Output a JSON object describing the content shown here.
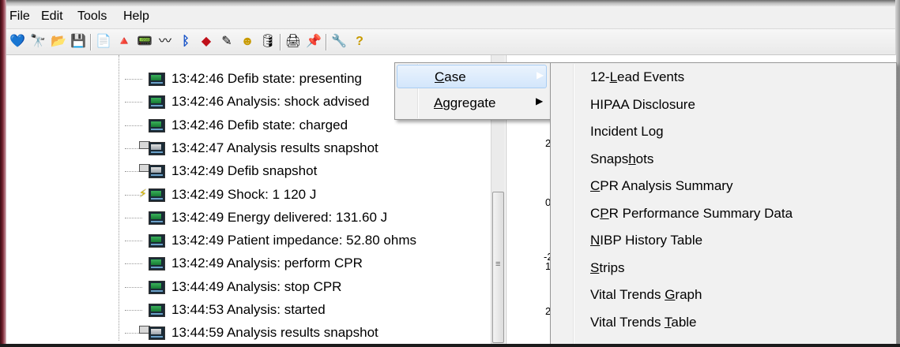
{
  "menubar": {
    "items": [
      {
        "label": "File"
      },
      {
        "label": "Edit"
      },
      {
        "label": "Tools"
      },
      {
        "label": "Help"
      }
    ]
  },
  "toolbar": {
    "buttons": [
      {
        "icon": "heart-icon",
        "glyph": "💙"
      },
      {
        "icon": "binoculars-icon",
        "glyph": "🔭"
      },
      {
        "icon": "open-folder-icon",
        "glyph": "📂"
      },
      {
        "icon": "save-disk-icon",
        "glyph": "💾"
      },
      {
        "icon": "new-document-icon",
        "glyph": "📄"
      },
      {
        "icon": "device-red-icon",
        "glyph": "🔺"
      },
      {
        "icon": "device-import-icon",
        "glyph": "📟"
      },
      {
        "icon": "waveform-icon",
        "glyph": "〰"
      },
      {
        "icon": "bluetooth-icon",
        "glyph": "ᛒ"
      },
      {
        "icon": "red-diamond-icon",
        "glyph": "◆"
      },
      {
        "icon": "pencil-icon",
        "glyph": "✎"
      },
      {
        "icon": "person-icon",
        "glyph": "☻"
      },
      {
        "icon": "database-icon",
        "glyph": "🛢"
      },
      {
        "icon": "printer-icon",
        "glyph": "🖨"
      },
      {
        "icon": "pushpin-icon",
        "glyph": "📌"
      },
      {
        "icon": "wrench-icon",
        "glyph": "🔧"
      },
      {
        "icon": "help-question-icon",
        "glyph": "?"
      }
    ]
  },
  "events": [
    {
      "text": "13:42:46 Defib state: presenting",
      "icon": "event"
    },
    {
      "text": "13:42:46 Analysis: shock advised",
      "icon": "event"
    },
    {
      "text": "13:42:46 Defib state: charged",
      "icon": "event"
    },
    {
      "text": "13:42:47 Analysis results snapshot",
      "icon": "snapshot"
    },
    {
      "text": "13:42:49 Defib snapshot",
      "icon": "snapshot"
    },
    {
      "text": "13:42:49 Shock: 1 120 J",
      "icon": "shock"
    },
    {
      "text": "13:42:49 Energy delivered: 131.60 J",
      "icon": "event"
    },
    {
      "text": "13:42:49 Patient impedance: 52.80 ohms",
      "icon": "event"
    },
    {
      "text": "13:42:49 Analysis: perform CPR",
      "icon": "event"
    },
    {
      "text": "13:44:49 Analysis: stop CPR",
      "icon": "event"
    },
    {
      "text": "13:44:53 Analysis: started",
      "icon": "event"
    },
    {
      "text": "13:44:59 Analysis results snapshot",
      "icon": "snapshot"
    }
  ],
  "right_pane": {
    "axis_labels": [
      "2",
      "0",
      "-2",
      "1",
      "2"
    ]
  },
  "context_menu": {
    "items": [
      {
        "label": "Case",
        "accel": "C",
        "rest": "ase",
        "has_submenu": true,
        "highlighted": true
      },
      {
        "label": "Aggregate",
        "accel": "A",
        "rest": "ggregate",
        "has_submenu": true,
        "highlighted": false
      }
    ]
  },
  "submenu": {
    "items": [
      {
        "label": "12-Lead Events",
        "pre": "12-",
        "accel": "L",
        "post": "ead Events"
      },
      {
        "label": "HIPAA Disclosure",
        "pre": "HIPAA Disclosure",
        "accel": "",
        "post": ""
      },
      {
        "label": "Incident Log",
        "pre": "Incident Log",
        "accel": "",
        "post": ""
      },
      {
        "label": "Snapshots",
        "pre": "Snaps",
        "accel": "h",
        "post": "ots"
      },
      {
        "label": "CPR Analysis Summary",
        "pre": "",
        "accel": "C",
        "post": "PR Analysis Summary"
      },
      {
        "label": "CPR Performance Summary Data",
        "pre": "C",
        "accel": "P",
        "post": "R Performance Summary Data"
      },
      {
        "label": "NIBP History Table",
        "pre": "",
        "accel": "N",
        "post": "IBP History Table"
      },
      {
        "label": "Strips",
        "pre": "",
        "accel": "S",
        "post": "trips"
      },
      {
        "label": "Vital Trends Graph",
        "pre": "Vital Trends ",
        "accel": "G",
        "post": "raph"
      },
      {
        "label": "Vital Trends Table",
        "pre": "Vital Trends ",
        "accel": "T",
        "post": "able"
      }
    ]
  },
  "scrollbar": {
    "grip": "≡"
  }
}
